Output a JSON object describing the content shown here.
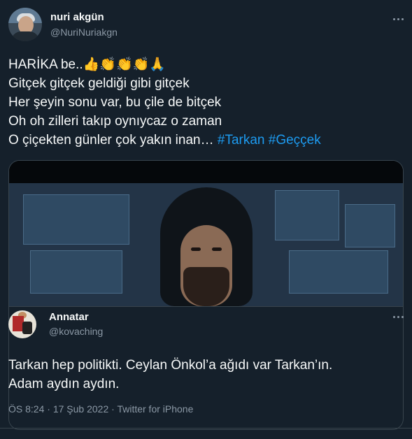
{
  "tweet": {
    "author": {
      "name": "nuri akgün",
      "handle": "@NuriNuriakgn"
    },
    "lines": [
      "HARİKA be..👍👏👏👏🙏",
      "Gitçek gitçek geldiği gibi gitçek",
      "Her şeyin sonu var, bu çile de bitçek",
      "Oh oh zilleri takıp oynıycaz o zaman"
    ],
    "last_line": {
      "text": "O çiçekten günler çok yakın inan… ",
      "hashtag1": "#Tarkan",
      "hashtag2": "#Geççek"
    },
    "media_icon": "video-thumbnail"
  },
  "quoted": {
    "author": {
      "name": "Annatar",
      "handle": "@kovaching"
    },
    "lines": [
      "Tarkan hep politikti. Ceylan Önkol’a ağıdı var Tarkan’ın.",
      "Adam aydın aydın."
    ]
  },
  "meta": {
    "time": "ÖS 8:24",
    "sep1": " · ",
    "date": "17 Şub 2022",
    "sep2": " · ",
    "source": "Twitter for iPhone"
  },
  "icons": {
    "more": "more-dots-icon"
  }
}
